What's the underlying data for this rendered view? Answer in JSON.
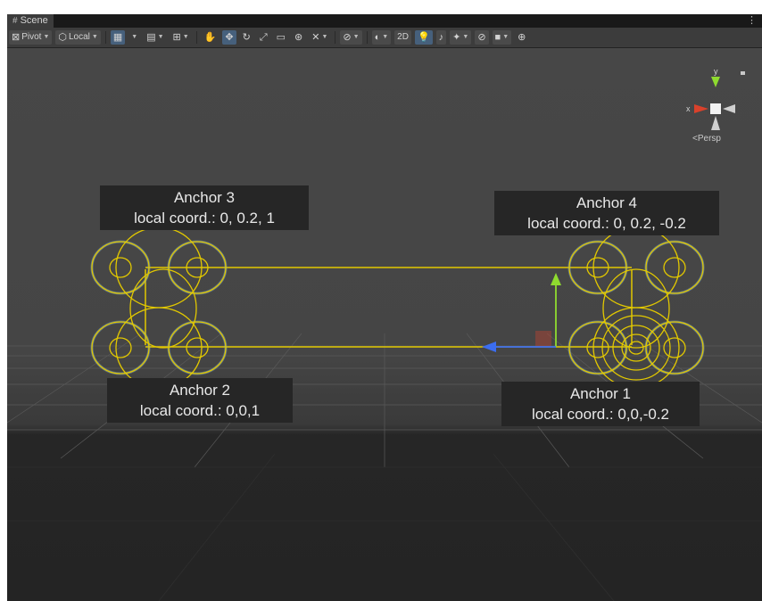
{
  "tab": {
    "title": "Scene",
    "menu": "⋮"
  },
  "toolbar": {
    "pivot_label": "Pivot",
    "local_label": "Local",
    "two_d_label": "2D"
  },
  "gizmo": {
    "x_label": "x",
    "y_label": "y",
    "persp_label": "Persp"
  },
  "anchors": [
    {
      "title": "Anchor 3",
      "coord": "local coord.: 0, 0.2, 1"
    },
    {
      "title": "Anchor 4",
      "coord": "local coord.: 0, 0.2, -0.2"
    },
    {
      "title": "Anchor 2",
      "coord": "local coord.: 0,0,1"
    },
    {
      "title": "Anchor 1",
      "coord": "local coord.: 0,0,-0.2"
    }
  ],
  "colors": {
    "gizmo_yellow": "#e2c800",
    "axis_x_red": "#d9412b",
    "axis_y_green": "#8fdb2f",
    "axis_z_blue": "#3b6df0",
    "background": "#474747"
  }
}
